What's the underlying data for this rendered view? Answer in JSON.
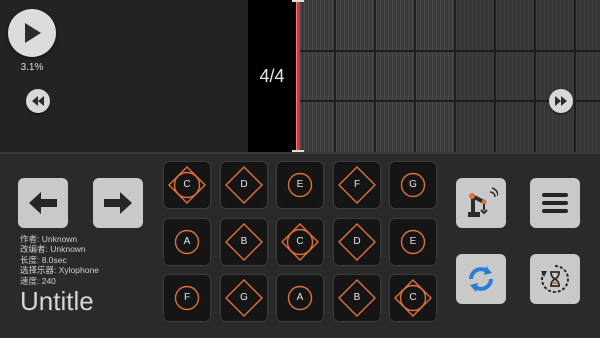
{
  "measure": "4/4",
  "transport": {
    "progress": "3.1%",
    "play_icon": "play-icon",
    "rewind_icon": "rewind-icon",
    "fast_forward_icon": "fast-forward-icon"
  },
  "song_info": {
    "author": "作者: Unknown",
    "arranger": "改编者: Unknown",
    "length": "长度: 8.0sec",
    "instrument": "选择乐器: Xylophone",
    "speed": "速度: 240",
    "title": "Untitle"
  },
  "pads": [
    {
      "note": "C",
      "shape": "both"
    },
    {
      "note": "D",
      "shape": "diamond"
    },
    {
      "note": "E",
      "shape": "circle"
    },
    {
      "note": "F",
      "shape": "diamond"
    },
    {
      "note": "G",
      "shape": "circle"
    },
    {
      "note": "A",
      "shape": "circle"
    },
    {
      "note": "B",
      "shape": "diamond"
    },
    {
      "note": "C",
      "shape": "both"
    },
    {
      "note": "D",
      "shape": "diamond"
    },
    {
      "note": "E",
      "shape": "circle"
    },
    {
      "note": "F",
      "shape": "circle"
    },
    {
      "note": "G",
      "shape": "diamond"
    },
    {
      "note": "A",
      "shape": "circle"
    },
    {
      "note": "B",
      "shape": "diamond"
    },
    {
      "note": "C",
      "shape": "both"
    }
  ],
  "colors": {
    "accent": "#e0703a",
    "pad_bg": "#151515",
    "playhead": "#c83c3c"
  }
}
